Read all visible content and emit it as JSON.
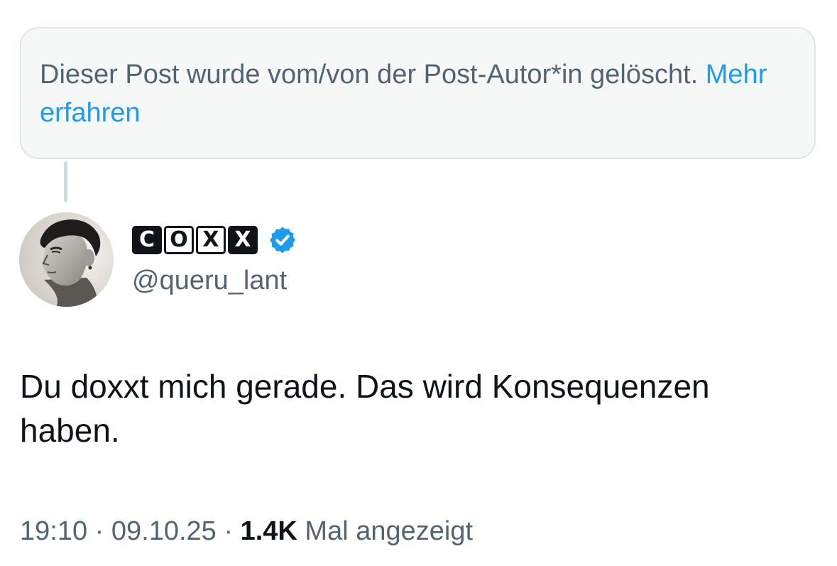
{
  "notice": {
    "text": "Dieser Post wurde vom/von der Post-Autor*in gelöscht.",
    "link_label": "Mehr erfahren"
  },
  "author": {
    "display_name_letters": [
      "C",
      "O",
      "X",
      "X"
    ],
    "verified_icon": "verified-badge-icon",
    "handle": "@queru_lant"
  },
  "tweet": {
    "text": "Du doxxt mich gerade. Das wird Konsequenzen haben."
  },
  "meta": {
    "time": "19:10",
    "separator": "·",
    "date": "09.10.25",
    "views_count": "1.4K",
    "views_label": "Mal angezeigt"
  },
  "colors": {
    "link": "#1d9bf0",
    "secondary_text": "#536471",
    "primary_text": "#0f1419",
    "notice_background": "#f6f8f8",
    "verified": "#1d9bf0"
  }
}
